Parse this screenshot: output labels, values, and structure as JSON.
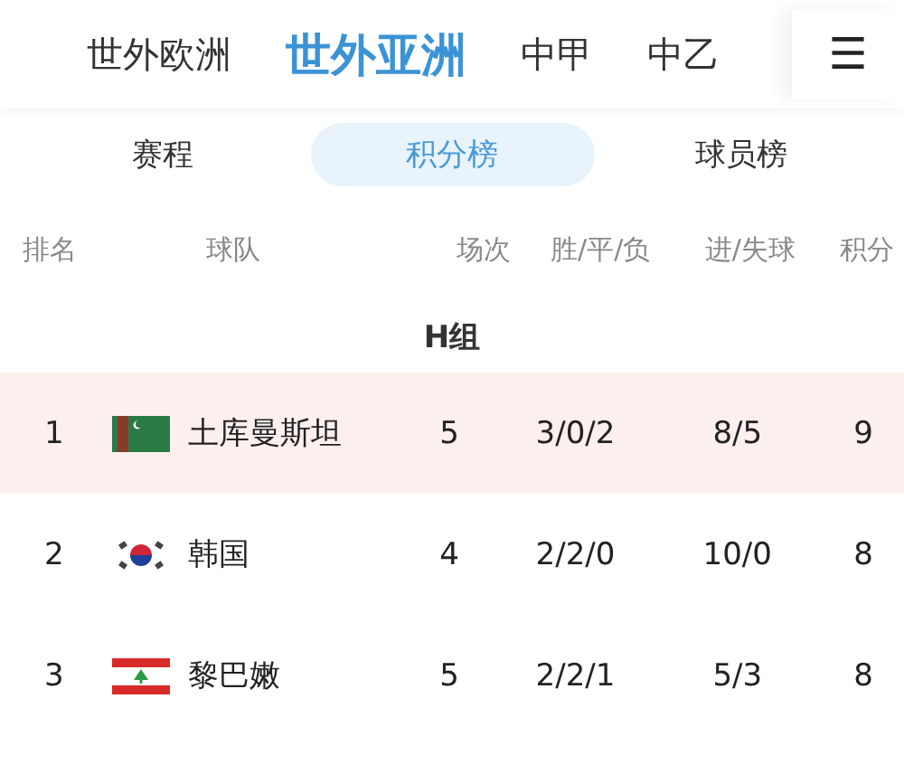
{
  "nav": {
    "items": [
      {
        "label": "世外欧洲",
        "selected": false
      },
      {
        "label": "世外亚洲",
        "selected": true
      },
      {
        "label": "中甲",
        "selected": false
      },
      {
        "label": "中乙",
        "selected": false
      }
    ],
    "menu": "☰"
  },
  "tabs": [
    {
      "label": "赛程",
      "selected": false
    },
    {
      "label": "积分榜",
      "selected": true
    },
    {
      "label": "球员榜",
      "selected": false
    }
  ],
  "table": {
    "columns": [
      "排名",
      "球队",
      "场次",
      "胜/平/负",
      "进/失球",
      "积分"
    ],
    "group": "H组",
    "rows": [
      {
        "rank": "1",
        "kind": "turkmenistan",
        "team": "土库曼斯坦",
        "played": "5",
        "wdl": "3/0/2",
        "goals": "8/5",
        "points": "9",
        "highlighted": true
      },
      {
        "rank": "2",
        "kind": "korea",
        "team": "韩国",
        "played": "4",
        "wdl": "2/2/0",
        "goals": "10/0",
        "points": "8",
        "highlighted": false
      },
      {
        "rank": "3",
        "kind": "lebanon",
        "team": "黎巴嫩",
        "played": "5",
        "wdl": "2/2/1",
        "goals": "5/3",
        "points": "8",
        "highlighted": false
      }
    ]
  }
}
